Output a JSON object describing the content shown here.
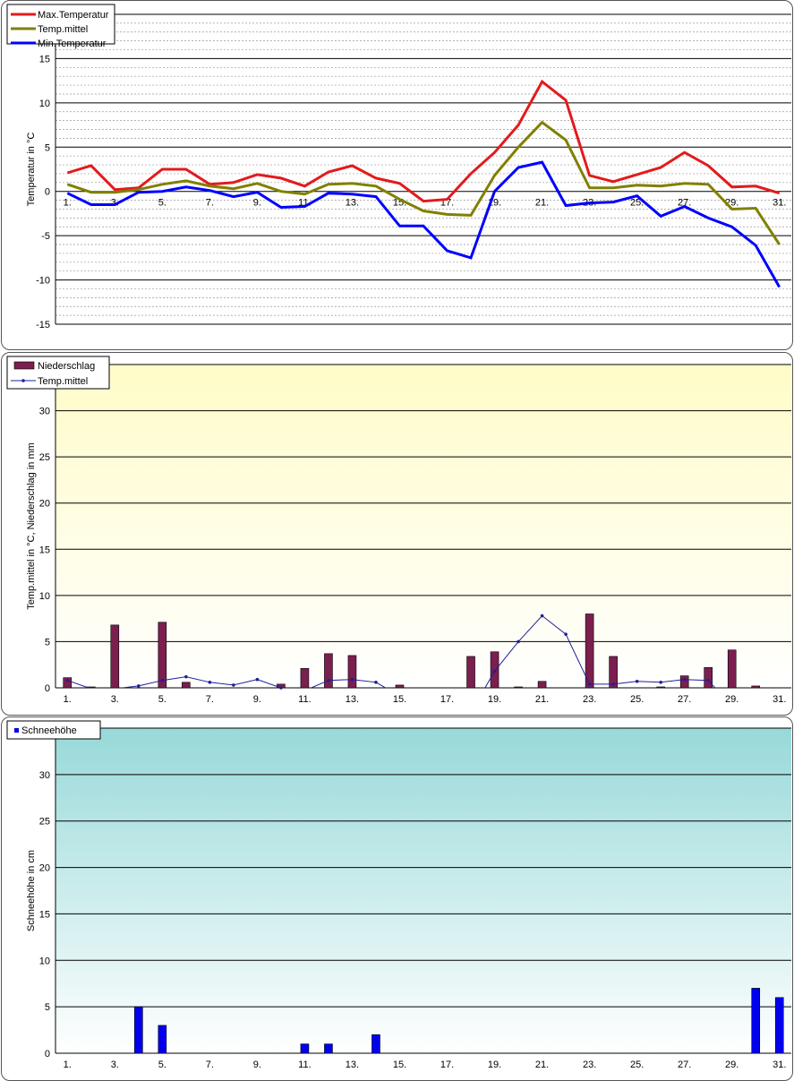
{
  "chart_data": [
    {
      "type": "line",
      "title": "",
      "xlabel": "",
      "ylabel": "Temperatur in °C",
      "ylim": [
        -15,
        20
      ],
      "yticks": [
        -15,
        -10,
        -5,
        0,
        5,
        10,
        15
      ],
      "grid": true,
      "legend_position": "top-left",
      "categories": [
        "1.",
        "",
        "3.",
        "",
        "5.",
        "",
        "7.",
        "",
        "9.",
        "",
        "11.",
        "",
        "13.",
        "",
        "15.",
        "",
        "17.",
        "",
        "19.",
        "",
        "21.",
        "",
        "23.",
        "",
        "25.",
        "",
        "27.",
        "",
        "29.",
        "",
        "31."
      ],
      "series": [
        {
          "name": "Max.Temperatur",
          "color": "#e31a1c",
          "values": [
            2.1,
            2.9,
            0.2,
            0.4,
            2.5,
            2.5,
            0.8,
            1.0,
            1.9,
            1.5,
            0.6,
            2.2,
            2.9,
            1.5,
            0.9,
            -1.1,
            -0.9,
            2.0,
            4.4,
            7.5,
            12.4,
            10.3,
            1.8,
            1.1,
            1.9,
            2.7,
            4.4,
            2.9,
            0.5,
            0.6,
            -0.2
          ]
        },
        {
          "name": "Temp.mittel",
          "color": "#808000",
          "values": [
            0.8,
            -0.1,
            -0.1,
            0.2,
            0.8,
            1.2,
            0.6,
            0.3,
            0.9,
            0.0,
            -0.3,
            0.8,
            0.9,
            0.6,
            -0.9,
            -2.2,
            -2.6,
            -2.7,
            1.8,
            5.0,
            7.8,
            5.8,
            0.4,
            0.4,
            0.7,
            0.6,
            0.9,
            0.8,
            -2.0,
            -1.9,
            -6.0
          ]
        },
        {
          "name": "Min.Temperatur",
          "color": "#0000ff",
          "values": [
            -0.2,
            -1.5,
            -1.5,
            -0.1,
            0.0,
            0.5,
            0.1,
            -0.6,
            -0.1,
            -1.8,
            -1.7,
            -0.2,
            -0.3,
            -0.6,
            -3.9,
            -3.9,
            -6.7,
            -7.5,
            0.0,
            2.7,
            3.3,
            -1.6,
            -1.3,
            -1.2,
            -0.5,
            -2.8,
            -1.7,
            -3.0,
            -4.0,
            -6.1,
            -10.8
          ]
        }
      ]
    },
    {
      "type": "bar",
      "title": "",
      "xlabel": "",
      "ylabel": "Temp.mittel  in °C, Niederschlag in mm",
      "ylim": [
        0,
        35
      ],
      "yticks": [
        0,
        5,
        10,
        15,
        20,
        25,
        30
      ],
      "grid": true,
      "legend_position": "top-left",
      "categories": [
        "1.",
        "",
        "3.",
        "",
        "5.",
        "",
        "7.",
        "",
        "9.",
        "",
        "11.",
        "",
        "13.",
        "",
        "15.",
        "",
        "17.",
        "",
        "19.",
        "",
        "21.",
        "",
        "23.",
        "",
        "25.",
        "",
        "27.",
        "",
        "29.",
        "",
        "31."
      ],
      "series": [
        {
          "name": "Niederschlag",
          "kind": "bar",
          "color": "#7b1f4f",
          "values": [
            1.1,
            0.1,
            6.8,
            0,
            7.1,
            0.6,
            0,
            0,
            0,
            0.4,
            2.1,
            3.7,
            3.5,
            0,
            0.3,
            0,
            0,
            3.4,
            3.9,
            0.1,
            0.7,
            0,
            8.0,
            3.4,
            0,
            0.1,
            1.3,
            2.2,
            4.1,
            0.2,
            0
          ]
        },
        {
          "name": "Temp.mittel",
          "kind": "line",
          "color": "#1f1f99",
          "values": [
            0.8,
            -0.1,
            -0.1,
            0.2,
            0.8,
            1.2,
            0.6,
            0.3,
            0.9,
            0.0,
            -0.3,
            0.8,
            0.9,
            0.6,
            -0.9,
            -2.2,
            -2.6,
            -2.7,
            1.8,
            5.0,
            7.8,
            5.8,
            0.4,
            0.4,
            0.7,
            0.6,
            0.9,
            0.8,
            -2.0,
            -1.9,
            -6.0
          ]
        }
      ]
    },
    {
      "type": "bar",
      "title": "",
      "xlabel": "",
      "ylabel": "Schneehöhe in cm",
      "ylim": [
        0,
        35
      ],
      "yticks": [
        0,
        5,
        10,
        15,
        20,
        25,
        30
      ],
      "grid": true,
      "legend_position": "top-left",
      "categories": [
        "1.",
        "",
        "3.",
        "",
        "5.",
        "",
        "7.",
        "",
        "9.",
        "",
        "11.",
        "",
        "13.",
        "",
        "15.",
        "",
        "17.",
        "",
        "19.",
        "",
        "21.",
        "",
        "23.",
        "",
        "25.",
        "",
        "27.",
        "",
        "29.",
        "",
        "31."
      ],
      "series": [
        {
          "name": "Schneehöhe",
          "kind": "bar",
          "color": "#0000ee",
          "values": [
            0,
            0,
            0,
            5,
            3,
            0,
            0,
            0,
            0,
            0,
            1,
            1,
            0,
            2,
            0,
            0,
            0,
            0,
            0,
            0,
            0,
            0,
            0,
            0,
            0,
            0,
            0,
            0,
            0,
            7,
            6
          ]
        }
      ]
    }
  ]
}
